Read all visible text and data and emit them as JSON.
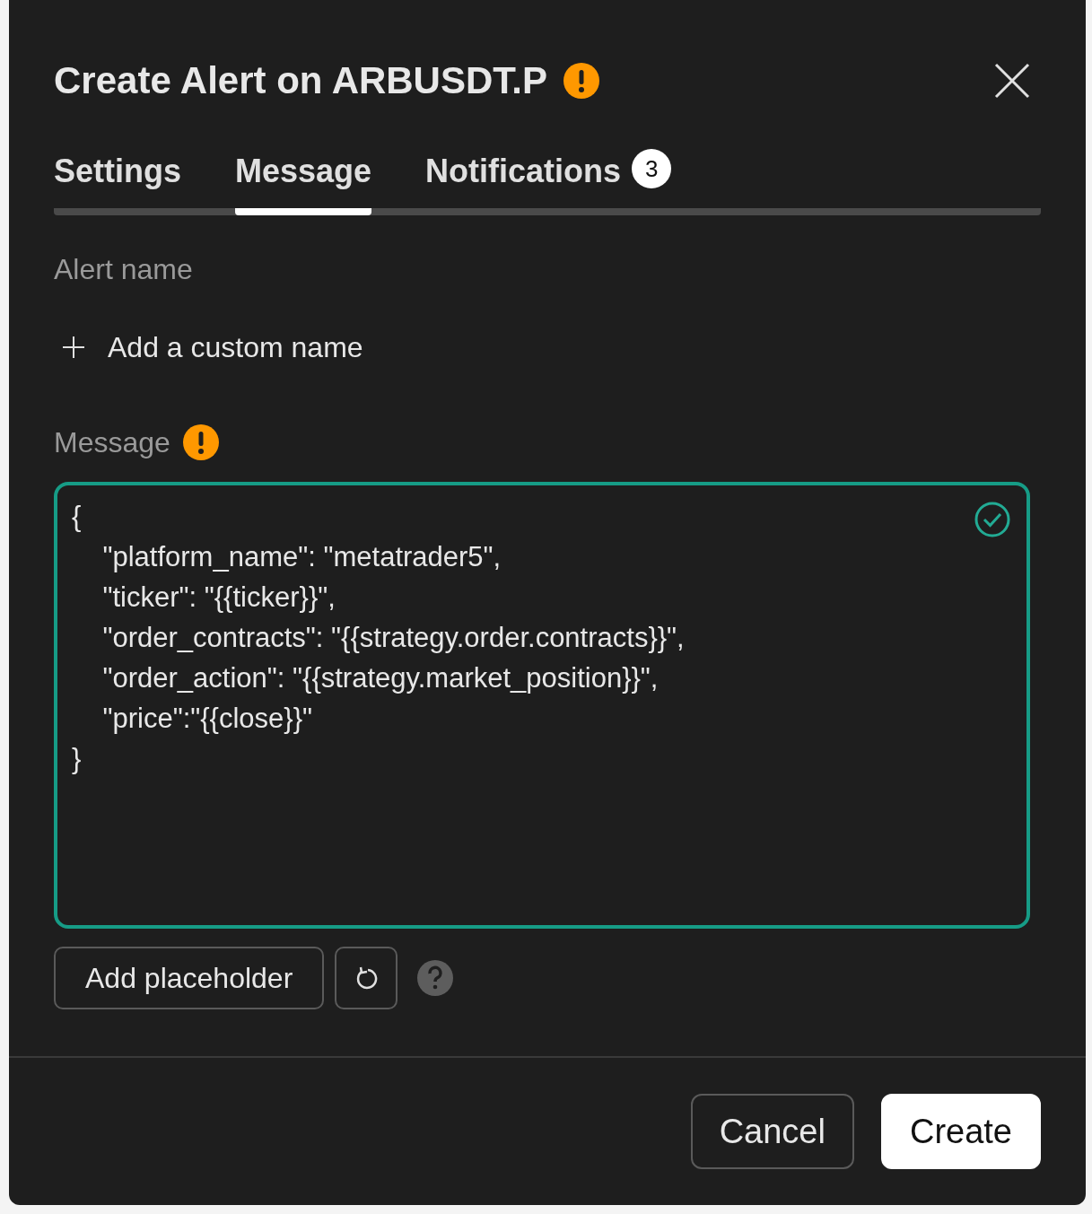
{
  "dialog": {
    "title": "Create Alert on ARBUSDT.P",
    "title_warning": true
  },
  "tabs": [
    {
      "label": "Settings",
      "selected": false
    },
    {
      "label": "Message",
      "selected": true
    },
    {
      "label": "Notifications",
      "selected": false,
      "badge": "3"
    }
  ],
  "alert_name": {
    "label": "Alert name",
    "add_button": "Add a custom name"
  },
  "message": {
    "label": "Message",
    "warning": true,
    "valid": true,
    "value": "{\n    \"platform_name\": \"metatrader5\",\n    \"ticker\": \"{{ticker}}\",\n    \"order_contracts\": \"{{strategy.order.contracts}}\",\n    \"order_action\": \"{{strategy.market_position}}\",\n    \"price\":\"{{close}}\"\n}"
  },
  "message_actions": {
    "placeholder_button": "Add placeholder"
  },
  "footer": {
    "buttons": [
      {
        "label": "Cancel",
        "kind": "secondary"
      },
      {
        "label": "Create",
        "kind": "primary"
      }
    ]
  }
}
